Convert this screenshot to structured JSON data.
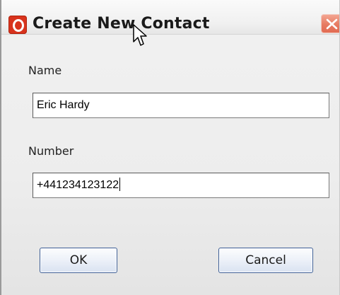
{
  "dialog": {
    "title": "Create New Contact"
  },
  "form": {
    "name_label": "Name",
    "name_value": "Eric Hardy",
    "number_label": "Number",
    "number_value": "+441234123122"
  },
  "buttons": {
    "ok_label": "OK",
    "cancel_label": "Cancel"
  },
  "icons": {
    "app": "opera-logo-icon",
    "close": "close-icon",
    "cursor": "mouse-pointer-icon"
  },
  "colors": {
    "app_icon": "#d8331d",
    "close_button": "#e77b62",
    "button_border": "#3e5f96"
  }
}
